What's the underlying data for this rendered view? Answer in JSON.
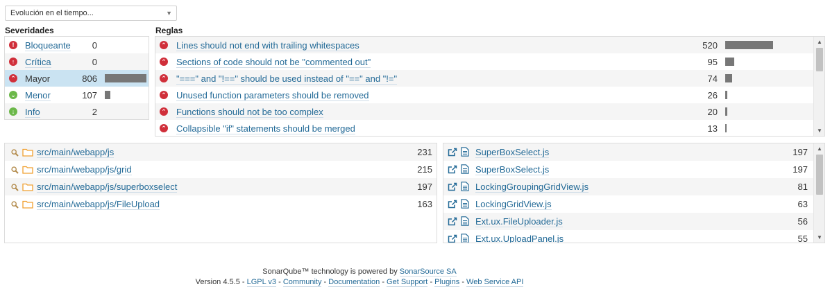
{
  "filter_select": {
    "value": "Evolución en el tiempo..."
  },
  "severities": {
    "title": "Severidades",
    "items": [
      {
        "label": "Bloqueante",
        "count": "0",
        "icon": "blocker-icon",
        "share": 0
      },
      {
        "label": "Crítica",
        "count": "0",
        "icon": "critical-icon",
        "share": 0
      },
      {
        "label": "Mayor",
        "count": "806",
        "icon": "major-icon",
        "share": 1.0,
        "selected": true
      },
      {
        "label": "Menor",
        "count": "107",
        "icon": "minor-icon",
        "share": 0.133
      },
      {
        "label": "Info",
        "count": "2",
        "icon": "info-icon",
        "share": 0
      }
    ]
  },
  "rules": {
    "title": "Reglas",
    "items": [
      {
        "label": "Lines should not end with trailing whitespaces",
        "count": "520",
        "share": 1.0
      },
      {
        "label": "Sections of code should not be \"commented out\"",
        "count": "95",
        "share": 0.183
      },
      {
        "label": "\"===\" and \"!==\" should be used instead of \"==\" and \"!=\"",
        "count": "74",
        "share": 0.142
      },
      {
        "label": "Unused function parameters should be removed",
        "count": "26",
        "share": 0.05
      },
      {
        "label": "Functions should not be too complex",
        "count": "20",
        "share": 0.038
      },
      {
        "label": "Collapsible \"if\" statements should be merged",
        "count": "13",
        "share": 0.025
      }
    ]
  },
  "directories": {
    "items": [
      {
        "label": "src/main/webapp/js",
        "count": "231"
      },
      {
        "label": "src/main/webapp/js/grid",
        "count": "215"
      },
      {
        "label": "src/main/webapp/js/superboxselect",
        "count": "197"
      },
      {
        "label": "src/main/webapp/js/FileUpload",
        "count": "163"
      }
    ]
  },
  "files": {
    "items": [
      {
        "label": "SuperBoxSelect.js",
        "count": "197"
      },
      {
        "label": "SuperBoxSelect.js",
        "count": "197"
      },
      {
        "label": "LockingGroupingGridView.js",
        "count": "81"
      },
      {
        "label": "LockingGridView.js",
        "count": "63"
      },
      {
        "label": "Ext.ux.FileUploader.js",
        "count": "56"
      },
      {
        "label": "Ext.ux.UploadPanel.js",
        "count": "55"
      }
    ]
  },
  "footer": {
    "powered_prefix": "SonarQube™ technology is powered by ",
    "powered_link": "SonarSource SA",
    "version": "Version 4.5.5",
    "links": [
      "LGPL v3",
      "Community",
      "Documentation",
      "Get Support",
      "Plugins",
      "Web Service API"
    ]
  },
  "colors": {
    "link": "#236a97",
    "bar": "#777777",
    "red": "#d02f3a",
    "green": "#6cb84a",
    "selected_row": "#cae3f2",
    "folder": "#f0a030"
  }
}
